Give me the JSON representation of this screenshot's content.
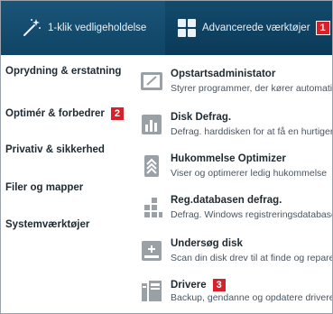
{
  "tabs": {
    "maintenance": {
      "label": "1-klik vedligeholdelse",
      "icon": "magic-wand-icon"
    },
    "advanced": {
      "label": "Advancerede værktøjer",
      "icon": "grid-icon",
      "badge": "1"
    }
  },
  "sidebar": {
    "items": [
      {
        "label": "Oprydning & erstatning"
      },
      {
        "label": "Optimér & forbedrer",
        "badge": "2"
      },
      {
        "label": "Privativ & sikkerhed"
      },
      {
        "label": "Filer og mapper"
      },
      {
        "label": "Systemværktøjer"
      }
    ]
  },
  "tools": [
    {
      "title": "Opstartsadministator",
      "desc": "Styrer programmer, der kører automatisk ved opstart",
      "icon": "startup-window-icon"
    },
    {
      "title": "Disk Defrag.",
      "desc": "Defrag. harddisken for at få en hurtigere computer",
      "icon": "disk-defrag-icon"
    },
    {
      "title": "Hukommelse Optimizer",
      "desc": "Viser og optimerer ledig hukommelse",
      "icon": "memory-optimizer-icon"
    },
    {
      "title": "Reg.databasen defrag.",
      "desc": "Defrag. Windows registreringsdatabasen",
      "icon": "registry-defrag-icon"
    },
    {
      "title": "Undersøg disk",
      "desc": "Scan din disk drev til at finde og reparere fejl",
      "icon": "check-disk-icon"
    },
    {
      "title": "Drivere",
      "desc": "Backup, gendanne og opdatere drivere",
      "icon": "drivers-icon",
      "badge": "3"
    }
  ],
  "colors": {
    "header": "#134a6c",
    "badge": "#d8202a"
  }
}
